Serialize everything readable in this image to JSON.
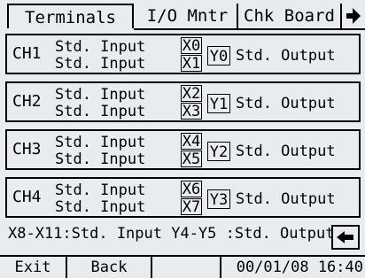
{
  "tabs": {
    "terminals": "Terminals",
    "io_monitor": "I/O Mntr",
    "check_board": "Chk Board"
  },
  "channels": [
    {
      "label": "CH1",
      "in1": "Std. Input",
      "in2": "Std. Input",
      "x1": "X0",
      "x2": "X1",
      "y": "Y0",
      "out": "Std. Output"
    },
    {
      "label": "CH2",
      "in1": "Std. Input",
      "in2": "Std. Input",
      "x1": "X2",
      "x2": "X3",
      "y": "Y1",
      "out": "Std. Output"
    },
    {
      "label": "CH3",
      "in1": "Std. Input",
      "in2": "Std. Input",
      "x1": "X4",
      "x2": "X5",
      "y": "Y2",
      "out": "Std. Output"
    },
    {
      "label": "CH4",
      "in1": "Std. Input",
      "in2": "Std. Input",
      "x1": "X6",
      "x2": "X7",
      "y": "Y3",
      "out": "Std. Output"
    }
  ],
  "note": "X8-X11:Std. Input Y4-Y5 :Std. Output",
  "footer": {
    "exit": "Exit",
    "back": "Back",
    "datetime": "00/01/08 16:40"
  },
  "icons": {
    "tab_next": "right-arrow-icon",
    "return": "left-arrow-icon"
  }
}
